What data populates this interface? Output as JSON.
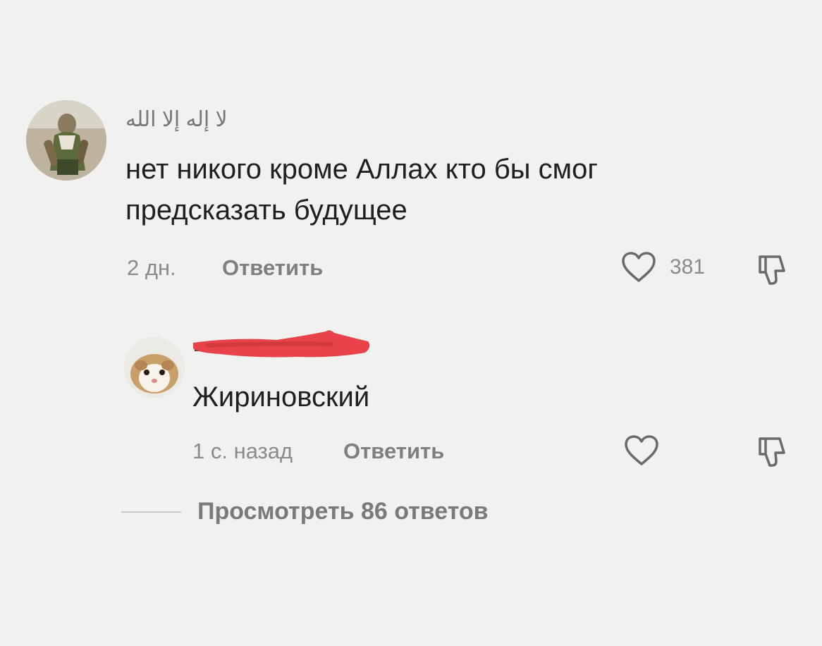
{
  "comment": {
    "username": "لا إله إلا الله",
    "text_line1": "нет никого кроме Аллах кто бы смог",
    "text_line2": "предсказать будущее",
    "time": "2 дн.",
    "reply_label": "Ответить",
    "like_count": "381",
    "like_icon": "heart-outline-icon",
    "dislike_icon": "thumbs-down-icon"
  },
  "reply": {
    "text": "Жириновский",
    "time": "1 с. назад",
    "reply_label": "Ответить",
    "like_icon": "heart-outline-icon",
    "dislike_icon": "thumbs-down-icon"
  },
  "view_replies": {
    "label": "Просмотреть 86 ответов"
  },
  "colors": {
    "background": "#f1f1f0",
    "text": "#1f1f1f",
    "muted": "#8a8a8a",
    "redaction": "#e8434a"
  }
}
